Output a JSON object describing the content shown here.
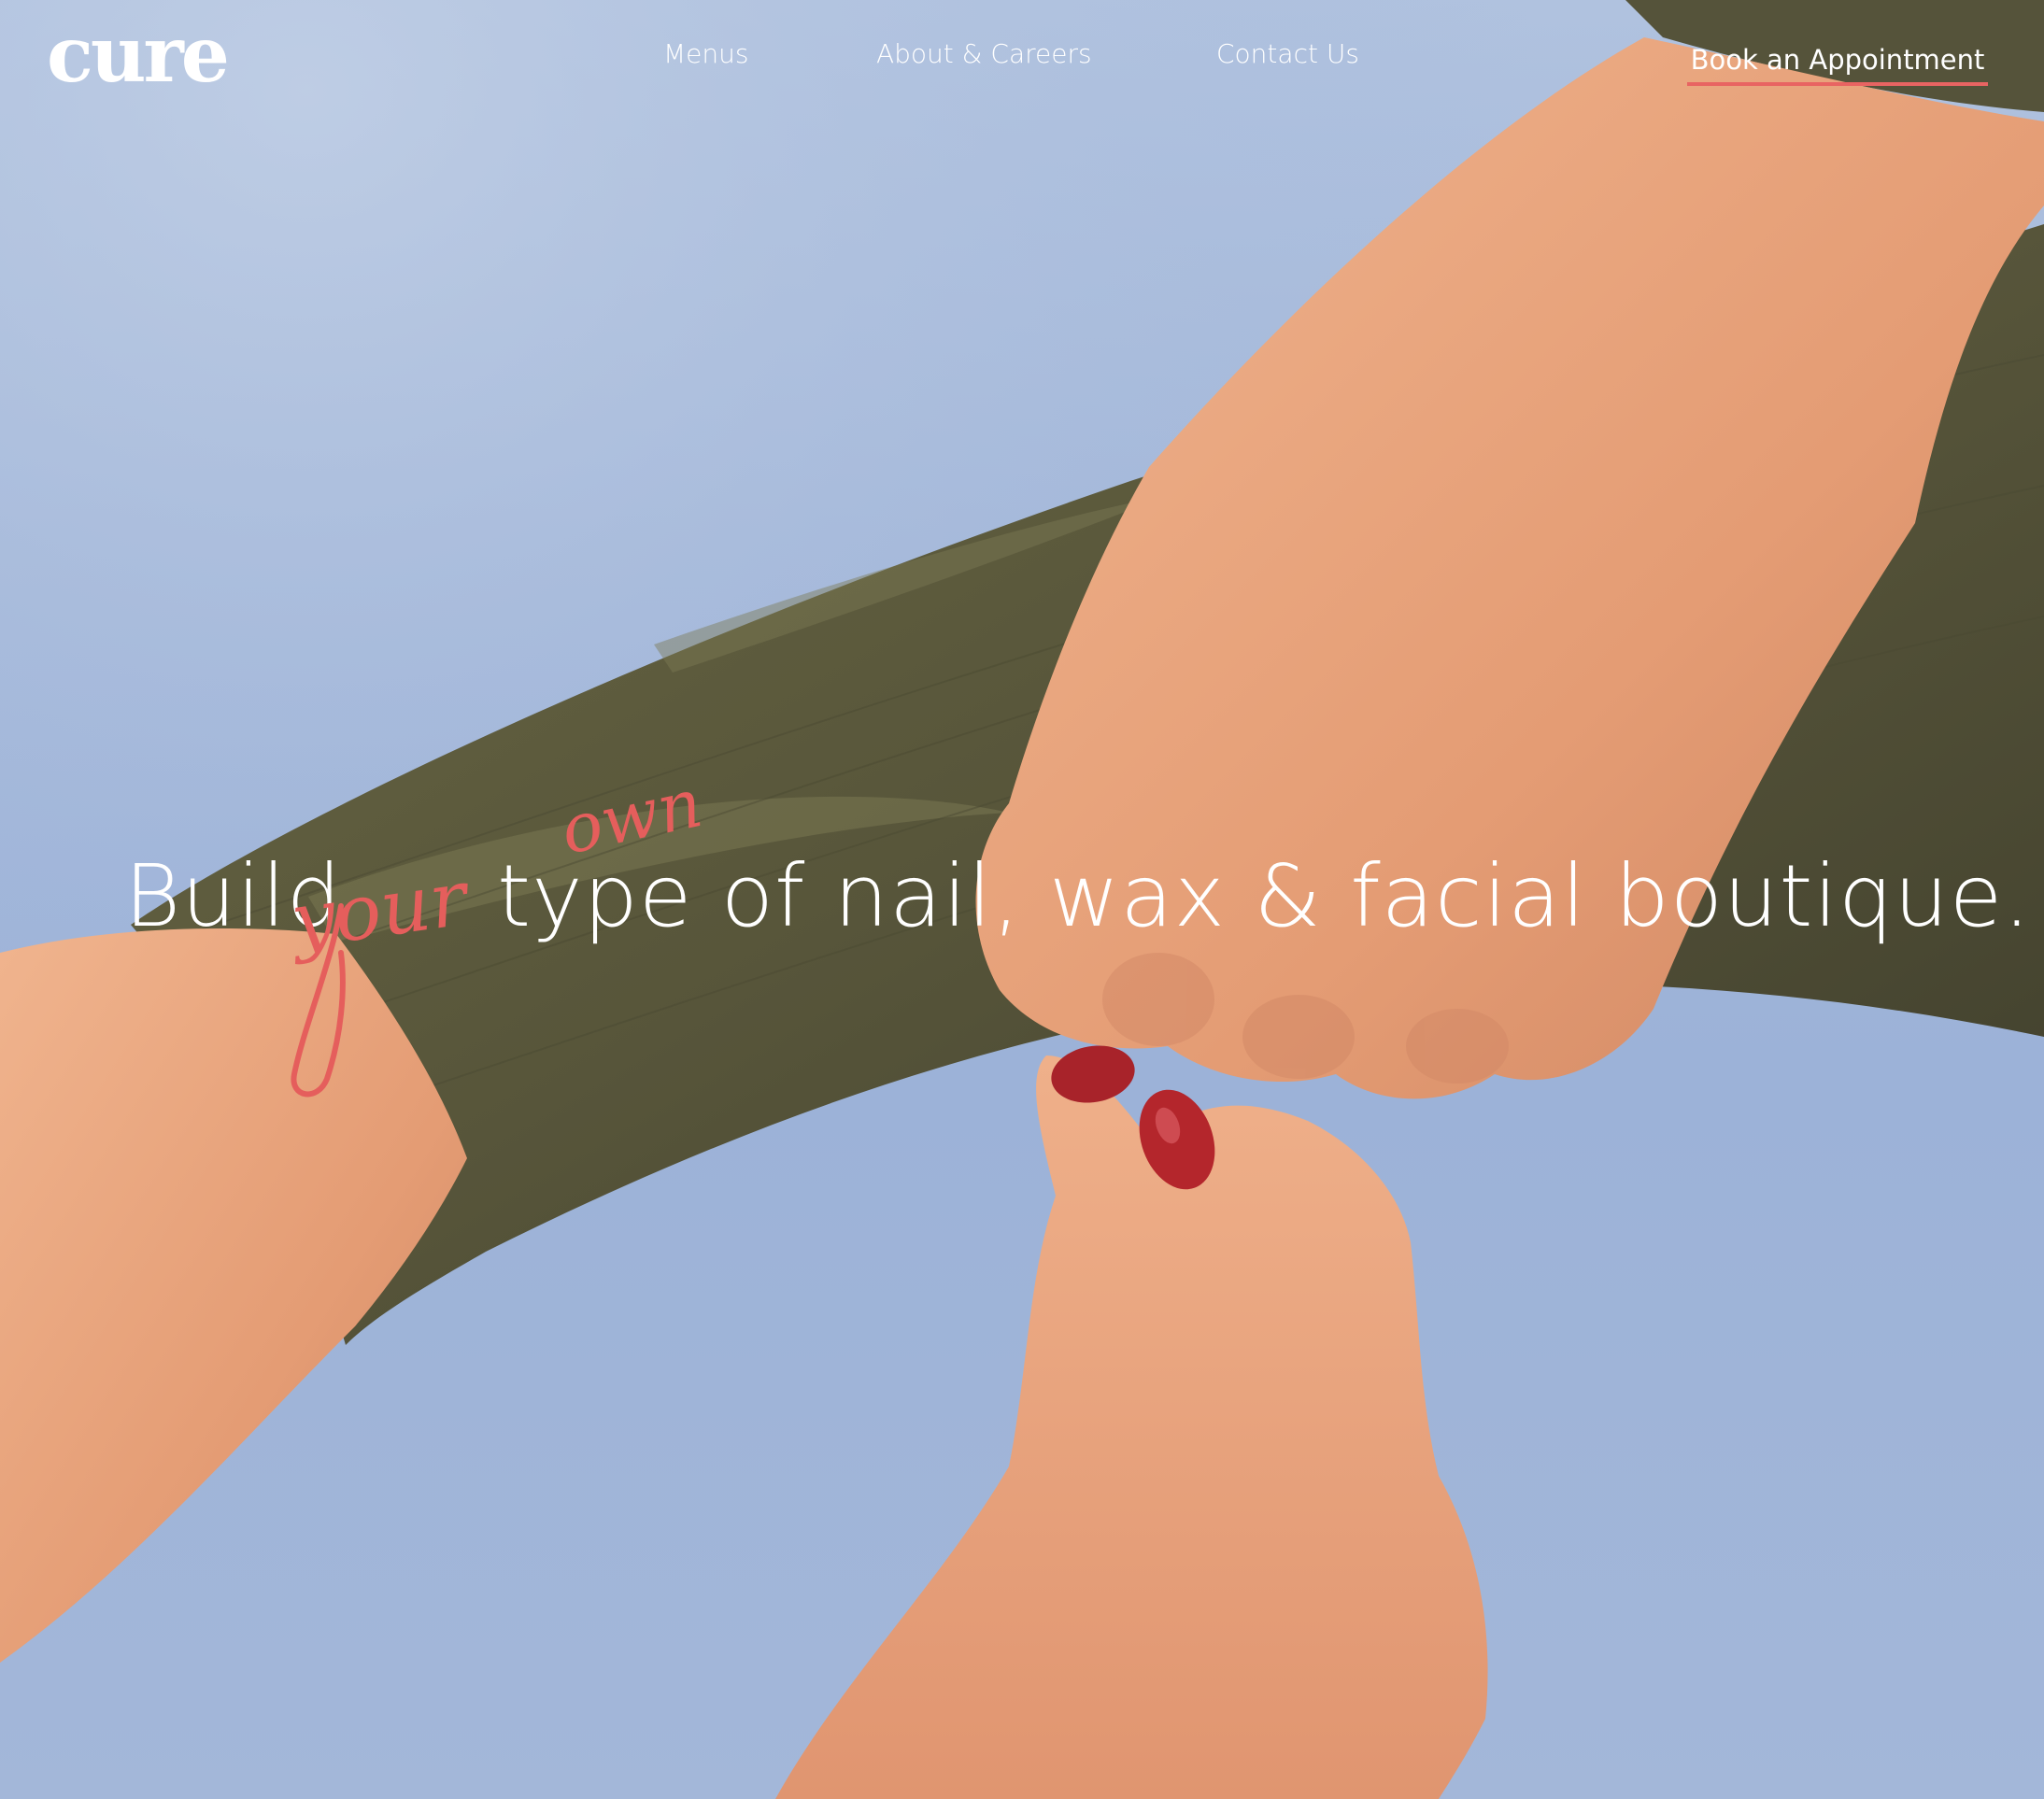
{
  "header": {
    "logo_text": "cure",
    "nav": {
      "menus": "Menus",
      "about": "About & Careers",
      "contact": "Contact Us"
    },
    "cta_label": "Book an Appointment"
  },
  "hero": {
    "headline_start": "Build",
    "headline_script_1": "your",
    "headline_script_2": "own",
    "headline_end": "type of nail, wax & facial boutique."
  },
  "colors": {
    "accent": "#e86462",
    "sky": "#a4b8da",
    "fabric": "#5c5a3c",
    "skin": "#e8a47c",
    "nail_polish": "#b4232a",
    "text": "#ffffff"
  }
}
